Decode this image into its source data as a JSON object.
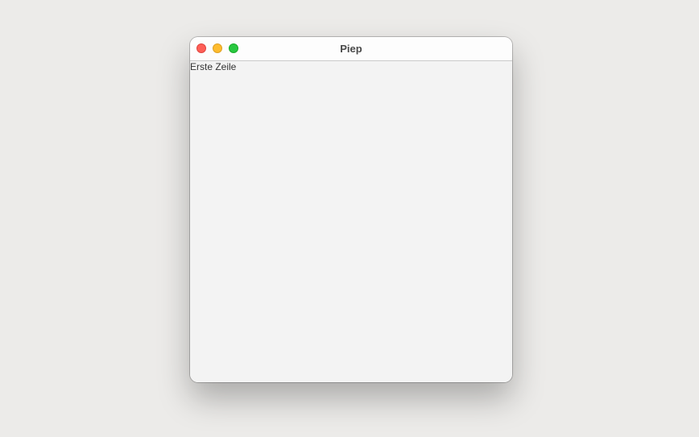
{
  "window": {
    "title": "Piep"
  },
  "content": {
    "lines": [
      "Erste Zeile"
    ]
  },
  "colors": {
    "desktop": "#ecebe9",
    "window_bg": "#f3f3f3",
    "titlebar_bg": "#fdfdfd",
    "close": "#fe5f57",
    "minimize": "#febc2e",
    "zoom": "#28c840"
  },
  "icons": {
    "close": "close-window-icon",
    "minimize": "minimize-window-icon",
    "zoom": "zoom-window-icon"
  }
}
